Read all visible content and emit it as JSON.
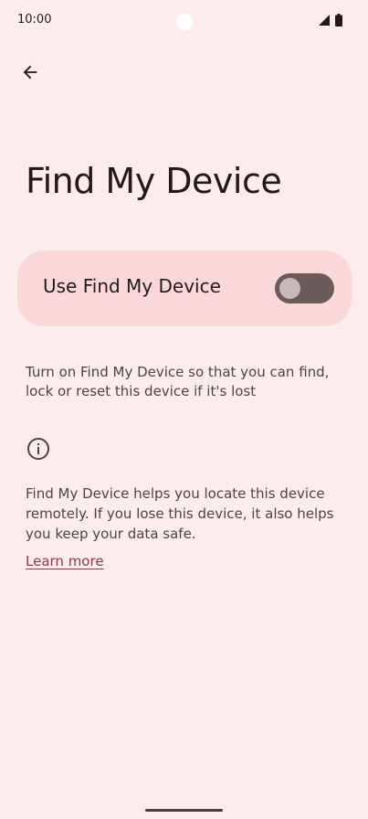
{
  "status_bar": {
    "time": "10:00",
    "icons": [
      "signal-icon",
      "battery-icon"
    ]
  },
  "toolbar": {
    "back_icon": "arrow-back-icon"
  },
  "page": {
    "title": "Find My Device"
  },
  "toggle": {
    "label": "Use Find My Device",
    "enabled": false
  },
  "description": "Turn on Find My Device so that you can find, lock or reset this device if it's lost",
  "footer": {
    "info_icon": "info-icon",
    "text": "Find My Device helps you locate this device remotely. If you lose this device, it also helps you keep your data safe.",
    "link_label": "Learn more"
  },
  "colors": {
    "background": "#fcecec",
    "card": "#fad8d8",
    "switch_track": "#6b5b5b",
    "switch_thumb": "#c9b8b8",
    "link": "#8b3b4f"
  }
}
